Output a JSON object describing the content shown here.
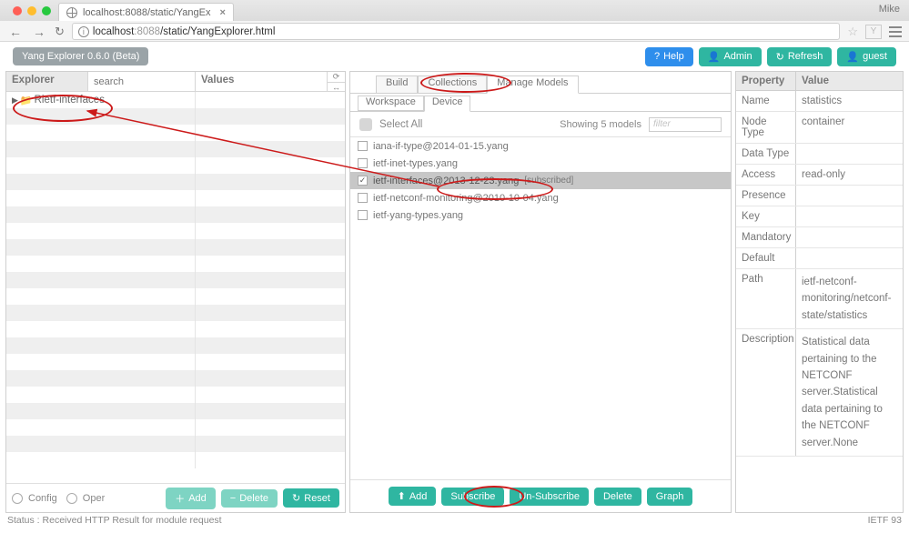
{
  "browser": {
    "tab_title": "localhost:8088/static/YangEx",
    "url_host": "localhost",
    "url_port": ":8088",
    "url_path": "/static/YangExplorer.html",
    "user_label": "Mike"
  },
  "appbar": {
    "beta_label": "Yang Explorer 0.6.0 (Beta)",
    "help": "Help",
    "admin": "Admin",
    "refresh": "Refresh",
    "guest": "guest"
  },
  "explorer": {
    "title": "Explorer",
    "search_placeholder": "search",
    "values_title": "Values",
    "tree_item": "Rietf-interfaces",
    "config_label": "Config",
    "oper_label": "Oper",
    "add_btn": "Add",
    "delete_btn": "Delete",
    "reset_btn": "Reset"
  },
  "center": {
    "tabs": [
      "Build",
      "Collections",
      "Manage Models"
    ],
    "subtabs": [
      "Workspace",
      "Device"
    ],
    "select_all": "Select All",
    "showing": "Showing 5 models",
    "filter_placeholder": "filter",
    "models": [
      {
        "name": "iana-if-type@2014-01-15.yang",
        "checked": false,
        "selected": false
      },
      {
        "name": "ietf-inet-types.yang",
        "checked": false,
        "selected": false
      },
      {
        "name": "ietf-interfaces@2013-12-23.yang",
        "checked": true,
        "selected": true,
        "tag": "[subscribed]"
      },
      {
        "name": "ietf-netconf-monitoring@2010-10-04.yang",
        "checked": false,
        "selected": false
      },
      {
        "name": "ietf-yang-types.yang",
        "checked": false,
        "selected": false
      }
    ],
    "footer": {
      "add": "Add",
      "subscribe": "Subscribe",
      "unsubscribe": "Un-Subscribe",
      "delete": "Delete",
      "graph": "Graph"
    }
  },
  "props": {
    "header_prop": "Property",
    "header_val": "Value",
    "rows": [
      {
        "k": "Name",
        "v": "statistics"
      },
      {
        "k": "Node Type",
        "v": "container"
      },
      {
        "k": "Data Type",
        "v": ""
      },
      {
        "k": "Access",
        "v": "read-only"
      },
      {
        "k": "Presence",
        "v": ""
      },
      {
        "k": "Key",
        "v": ""
      },
      {
        "k": "Mandatory",
        "v": ""
      },
      {
        "k": "Default",
        "v": ""
      },
      {
        "k": "Path",
        "v": "ietf-netconf-monitoring/netconf-state/statistics"
      },
      {
        "k": "Description",
        "v": "Statistical data pertaining to the NETCONF server.Statistical data pertaining to the NETCONF server.None"
      }
    ]
  },
  "status": {
    "left": "Status : Received HTTP Result for module request",
    "right": "IETF 93"
  }
}
